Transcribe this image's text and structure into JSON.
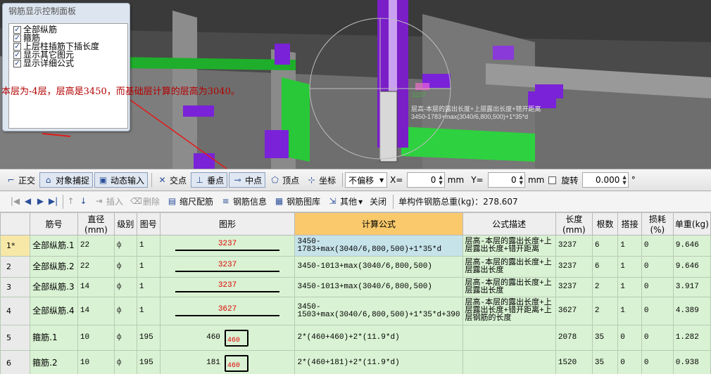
{
  "panel": {
    "title": "钢筋显示控制面板",
    "options": [
      {
        "label": "全部纵筋",
        "checked": true
      },
      {
        "label": "箍筋",
        "checked": true
      },
      {
        "label": "上层柱插筋下插长度",
        "checked": true
      },
      {
        "label": "显示其它图元",
        "checked": true
      },
      {
        "label": "显示详细公式",
        "checked": true
      }
    ]
  },
  "annotation": "本层为-4层，层高是3450，而基础层计算的层高为3040。",
  "viewport_labels": {
    "dim_value": "3237",
    "formula_desc": "层高-本层的露出长度+上层露出长度+错开距离",
    "formula": "3450-1783+max(3040/6,800,500)+1*35*d"
  },
  "snap_toolbar": {
    "ortho": "正交",
    "object_snap": "对象捕捉",
    "dynamic_input": "动态输入",
    "intersection": "交点",
    "perpendicular": "垂点",
    "midpoint": "中点",
    "vertex": "顶点",
    "coordinate": "坐标",
    "offset_mode": "不偏移",
    "x_label": "X=",
    "x_value": "0",
    "y_label": "Y=",
    "y_value": "0",
    "unit": "mm",
    "rotate_label": "旋转",
    "rotate_value": "0.000",
    "degree": "°"
  },
  "rebar_toolbar": {
    "insert": "插入",
    "delete": "删除",
    "scale_rebar": "缩尺配筋",
    "rebar_info": "钢筋信息",
    "rebar_library": "钢筋图库",
    "other": "其他",
    "close": "关闭",
    "total_label": "单构件钢筋总重(kg)：278.607"
  },
  "table": {
    "headers": [
      "",
      "筋号",
      "直径(mm)",
      "级别",
      "图号",
      "图形",
      "计算公式",
      "公式描述",
      "长度(mm)",
      "根数",
      "搭接",
      "损耗(%)",
      "单重(kg)"
    ],
    "rows": [
      {
        "idx": "1*",
        "name": "全部纵筋.1",
        "dia": "22",
        "grade": "ф",
        "fig": "1",
        "shape": "3237",
        "formula": "3450-1783+max(3040/6,800,500)+1*35*d",
        "desc": "层高-本层的露出长度+上层露出长度+错开距离",
        "len": "3237",
        "count": "6",
        "lap": "1",
        "loss": "0",
        "weight": "9.646"
      },
      {
        "idx": "2",
        "name": "全部纵筋.2",
        "dia": "22",
        "grade": "ф",
        "fig": "1",
        "shape": "3237",
        "formula": "3450-1013+max(3040/6,800,500)",
        "desc": "层高-本层的露出长度+上层露出长度",
        "len": "3237",
        "count": "6",
        "lap": "1",
        "loss": "0",
        "weight": "9.646"
      },
      {
        "idx": "3",
        "name": "全部纵筋.3",
        "dia": "14",
        "grade": "ф",
        "fig": "1",
        "shape": "3237",
        "formula": "3450-1013+max(3040/6,800,500)",
        "desc": "层高-本层的露出长度+上层露出长度",
        "len": "3237",
        "count": "2",
        "lap": "1",
        "loss": "0",
        "weight": "3.917"
      },
      {
        "idx": "4",
        "name": "全部纵筋.4",
        "dia": "14",
        "grade": "ф",
        "fig": "1",
        "shape": "3627",
        "formula": "3450-1503+max(3040/6,800,500)+1*35*d+390",
        "desc": "层高-本层的露出长度+上层露出长度+错开距离+上层钢筋的长度",
        "len": "3627",
        "count": "2",
        "lap": "1",
        "loss": "0",
        "weight": "4.389"
      },
      {
        "idx": "5",
        "name": "箍筋.1",
        "dia": "10",
        "grade": "ф",
        "fig": "195",
        "shape_a": "460",
        "shape_b": "460",
        "formula": "2*(460+460)+2*(11.9*d)",
        "desc": "",
        "len": "2078",
        "count": "35",
        "lap": "0",
        "loss": "0",
        "weight": "1.282"
      },
      {
        "idx": "6",
        "name": "箍筋.2",
        "dia": "10",
        "grade": "ф",
        "fig": "195",
        "shape_a": "181",
        "shape_b": "460",
        "formula": "2*(460+181)+2*(11.9*d)",
        "desc": "",
        "len": "1520",
        "count": "35",
        "lap": "0",
        "loss": "0",
        "weight": "0.938"
      }
    ]
  }
}
